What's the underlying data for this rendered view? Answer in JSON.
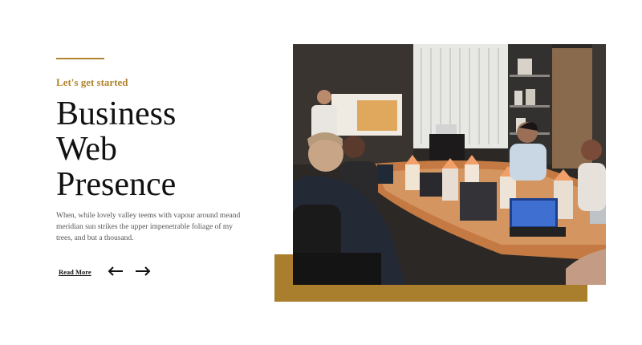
{
  "hero": {
    "eyebrow": "Let's get started",
    "title_lines": [
      "Business",
      "Web",
      "Presence"
    ],
    "description": "When, while lovely valley teems with vapour around meand meridian sun strikes the upper impenetrable foliage of my trees, and but a thousand.",
    "read_more_label": "Read More",
    "prev_icon": "arrow-left-icon",
    "next_icon": "arrow-right-icon"
  },
  "colors": {
    "accent": "#b1842e",
    "gold_block": "#a97e2c",
    "title": "#111111",
    "body_text": "#555555"
  }
}
